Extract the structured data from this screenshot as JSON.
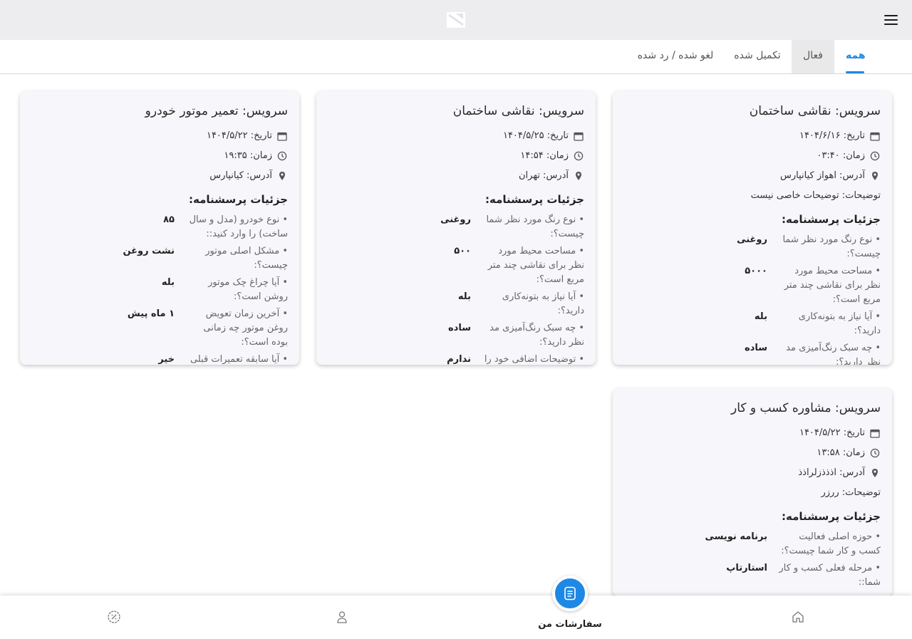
{
  "tabs": [
    {
      "label": "همه",
      "active": true
    },
    {
      "label": "فعال",
      "active": false
    },
    {
      "label": "تکمیل شده",
      "active": false
    },
    {
      "label": "لغو شده / رد شده",
      "active": false
    }
  ],
  "cards": [
    {
      "title": "سرویس: نقاشی ساختمان",
      "date": "تاریخ: ۱۴۰۴/۶/۱۶",
      "time": "زمان: ۰۳:۴۰",
      "address": "آدرس: اهواز کیانپارس",
      "description": "توضیحات: توضیحات خاصی نیست",
      "section_title": "جزئیات پرسشنامه:",
      "qa": [
        {
          "q": "• نوع رنگ مورد نظر شما چیست؟:",
          "a": "روغنی"
        },
        {
          "q": "• مساحت محیط مورد نظر برای نقاشی چند متر مربع است؟:",
          "a": "۵۰۰۰"
        },
        {
          "q": "• آیا نیاز به بتونه‌کاری دارید؟:",
          "a": "بله"
        },
        {
          "q": "• چه سبک رنگ‌آمیزی مد نظر دارید؟:",
          "a": "ساده"
        }
      ]
    },
    {
      "title": "سرویس: نقاشی ساختمان",
      "date": "تاریخ: ۱۴۰۴/۵/۲۵",
      "time": "زمان: ۱۴:۵۴",
      "address": "آدرس: تهران",
      "description": "",
      "section_title": "جزئیات پرسشنامه:",
      "qa": [
        {
          "q": "• نوع رنگ مورد نظر شما چیست؟:",
          "a": "روغنی"
        },
        {
          "q": "• مساحت محیط مورد نظر برای نقاشی چند متر مربع است؟:",
          "a": "۵۰۰"
        },
        {
          "q": "• آیا نیاز به بتونه‌کاری دارید؟:",
          "a": "بله"
        },
        {
          "q": "• چه سبک رنگ‌آمیزی مد نظر دارید؟:",
          "a": "ساده"
        },
        {
          "q": "• توضیحات اضافی خود را",
          "a": "ندارم"
        }
      ]
    },
    {
      "title": "سرویس: تعمیر موتور خودرو",
      "date": "تاریخ: ۱۴۰۴/۵/۲۲",
      "time": "زمان: ۱۹:۳۵",
      "address": "آدرس: کیانپارس",
      "description": "",
      "section_title": "جزئیات پرسشنامه:",
      "qa": [
        {
          "q": "• نوع خودرو (مدل و سال ساخت) را وارد کنید::",
          "a": "۸۵"
        },
        {
          "q": "• مشکل اصلی موتور چیست؟:",
          "a": "نشت روغن"
        },
        {
          "q": "• آیا چراغ چک موتور روشن است؟:",
          "a": "بله"
        },
        {
          "q": "• آخرین زمان تعویض روغن موتور چه زمانی بوده است؟:",
          "a": "۱ ماه پیش"
        },
        {
          "q": "• آیا سابقه تعمیرات قبلی",
          "a": "خیر"
        }
      ]
    },
    {
      "title": "سرویس: مشاوره کسب و کار",
      "date": "تاریخ: ۱۴۰۴/۵/۲۲",
      "time": "زمان: ۱۳:۵۸",
      "address": "آدرس: اذذذزلراذذ",
      "description": "توضیحات: ررزر",
      "section_title": "جزئیات پرسشنامه:",
      "qa": [
        {
          "q": "• حوزه اصلی فعالیت کسب و کار شما چیست؟:",
          "a": "برنامه نویسی"
        },
        {
          "q": "• مرحله فعلی کسب و کار شما::",
          "a": "استارتاپ"
        }
      ]
    }
  ],
  "bottom_nav": {
    "active_label": "سفارشات من"
  },
  "colors": {
    "accent": "#1e88e5",
    "header_bg": "#ededf0",
    "card_bg": "#f7f6fa"
  }
}
